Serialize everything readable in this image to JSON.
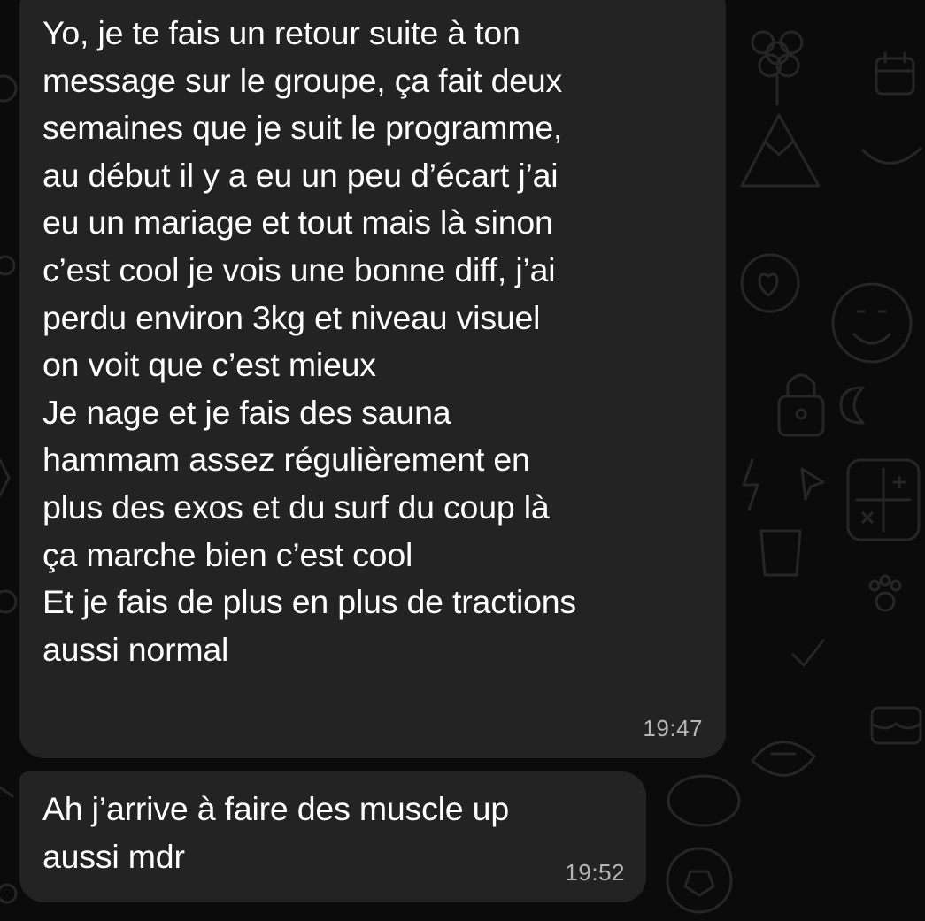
{
  "conversation": {
    "messages": [
      {
        "lines": [
          "Yo, je te fais un retour suite à ton",
          "message sur le groupe, ça fait deux",
          "semaines que je suit le programme,",
          "au début il y a eu un peu d’écart j’ai",
          "eu un mariage et tout mais là sinon",
          "c’est cool je vois une bonne diff, j’ai",
          "perdu environ 3kg et niveau visuel",
          "on voit que c’est mieux",
          "Je nage et je fais des sauna",
          "hammam assez régulièrement en",
          "plus des exos et du surf du coup là",
          "ça marche bien c’est cool",
          "Et je fais de plus en plus de tractions",
          "aussi normal"
        ],
        "time": "19:47"
      },
      {
        "lines": [
          "Ah j’arrive à faire des muscle up",
          "aussi mdr"
        ],
        "time": "19:52"
      }
    ]
  },
  "theme": {
    "background": "#0b0b0b",
    "bubble_color": "#232323",
    "text_color": "#ffffff",
    "time_color": "#b5b5b5",
    "wallpaper_icons": [
      "flower-icon",
      "calendar-icon",
      "mountain-icon",
      "heart-icon",
      "smiley-icon",
      "lock-icon",
      "moon-icon",
      "lightning-icon",
      "cursor-icon",
      "calculator-icon",
      "paw-icon",
      "checkmark-icon",
      "football-icon",
      "cake-icon",
      "cup-icon",
      "soccer-ball-icon"
    ]
  }
}
